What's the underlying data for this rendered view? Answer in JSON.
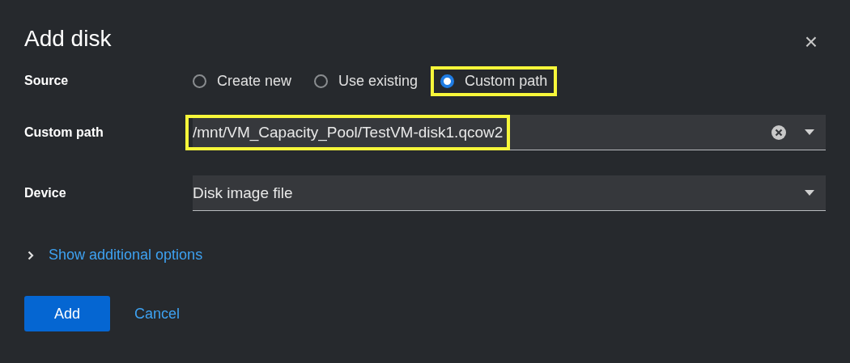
{
  "dialog": {
    "title": "Add disk",
    "close": "×"
  },
  "source": {
    "label": "Source",
    "options": [
      {
        "label": "Create new",
        "selected": false,
        "highlighted": false
      },
      {
        "label": "Use existing",
        "selected": false,
        "highlighted": false
      },
      {
        "label": "Custom path",
        "selected": true,
        "highlighted": true
      }
    ]
  },
  "custom_path": {
    "label": "Custom path",
    "value": "/mnt/VM_Capacity_Pool/TestVM-disk1.qcow2",
    "highlighted": true
  },
  "device": {
    "label": "Device",
    "value": "Disk image file"
  },
  "additional_options": {
    "label": "Show additional options",
    "expanded": false
  },
  "buttons": [
    {
      "label": "Add",
      "kind": "primary"
    },
    {
      "label": "Cancel",
      "kind": "link"
    }
  ]
}
